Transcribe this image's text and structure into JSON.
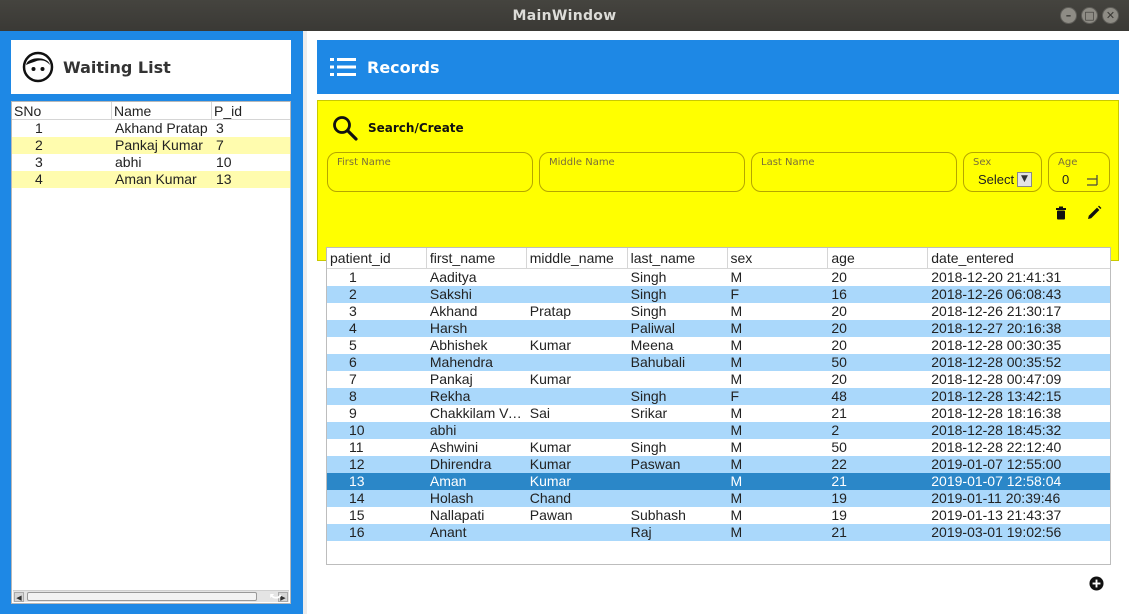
{
  "window": {
    "title": "MainWindow",
    "min": "–",
    "max": "□",
    "close": "✕"
  },
  "waiting_list": {
    "title": "Waiting List",
    "columns": [
      "SNo",
      "Name",
      "P_id"
    ],
    "rows": [
      {
        "sno": "1",
        "name": "Akhand Pratap",
        "pid": "3"
      },
      {
        "sno": "2",
        "name": "Pankaj Kumar",
        "pid": "7"
      },
      {
        "sno": "3",
        "name": "abhi",
        "pid": "10"
      },
      {
        "sno": "4",
        "name": "Aman Kumar",
        "pid": "13"
      }
    ]
  },
  "records": {
    "title": "Records",
    "search": {
      "title": "Search/Create",
      "first_name_label": "First Name",
      "middle_name_label": "Middle Name",
      "last_name_label": "Last Name",
      "sex_label": "Sex",
      "sex_value": "Select",
      "age_label": "Age",
      "age_value": "0"
    },
    "columns": [
      "patient_id",
      "first_name",
      "middle_name",
      "last_name",
      "sex",
      "age",
      "date_entered"
    ],
    "rows": [
      [
        "1",
        "Aaditya",
        "",
        "Singh",
        "M",
        "20",
        "2018-12-20 21:41:31"
      ],
      [
        "2",
        "Sakshi",
        "",
        "Singh",
        "F",
        "16",
        "2018-12-26 06:08:43"
      ],
      [
        "3",
        "Akhand",
        "Pratap",
        "Singh",
        "M",
        "20",
        "2018-12-26 21:30:17"
      ],
      [
        "4",
        "Harsh",
        "",
        "Paliwal",
        "M",
        "20",
        "2018-12-27 20:16:38"
      ],
      [
        "5",
        "Abhishek",
        "Kumar",
        "Meena",
        "M",
        "20",
        "2018-12-28 00:30:35"
      ],
      [
        "6",
        "Mahendra",
        "",
        "Bahubali",
        "M",
        "50",
        "2018-12-28 00:35:52"
      ],
      [
        "7",
        "Pankaj",
        "Kumar",
        "",
        "M",
        "20",
        "2018-12-28 00:47:09"
      ],
      [
        "8",
        "Rekha",
        "",
        "Singh",
        "F",
        "48",
        "2018-12-28 13:42:15"
      ],
      [
        "9",
        "Chakkilam Venkata",
        "Sai",
        "Srikar",
        "M",
        "21",
        "2018-12-28 18:16:38"
      ],
      [
        "10",
        "abhi",
        "",
        "",
        "M",
        "2",
        "2018-12-28 18:45:32"
      ],
      [
        "11",
        "Ashwini",
        "Kumar",
        "Singh",
        "M",
        "50",
        "2018-12-28 22:12:40"
      ],
      [
        "12",
        "Dhirendra",
        "Kumar",
        "Paswan",
        "M",
        "22",
        "2019-01-07 12:55:00"
      ],
      [
        "13",
        "Aman",
        "Kumar",
        "",
        "M",
        "21",
        "2019-01-07 12:58:04"
      ],
      [
        "14",
        "Holash",
        "Chand",
        "",
        "M",
        "19",
        "2019-01-11 20:39:46"
      ],
      [
        "15",
        "Nallapati",
        "Pawan",
        "Subhash",
        "M",
        "19",
        "2019-01-13 21:43:37"
      ],
      [
        "16",
        "Anant",
        "",
        "Raj",
        "M",
        "21",
        "2019-03-01 19:02:56"
      ]
    ],
    "selected_row_index": 12
  },
  "icons": {
    "face": "face-icon",
    "list": "list-icon",
    "search": "search-icon",
    "delete": "trash-icon",
    "edit": "pencil-icon",
    "add": "plus-circle-icon",
    "refresh": "refresh-icon"
  },
  "colors": {
    "accent": "#1e88e5",
    "search_bg": "#ffff00",
    "waiting_alt_row": "#fffcae",
    "records_alt_row": "#aad8fb",
    "selected_row": "#2b87c8"
  }
}
